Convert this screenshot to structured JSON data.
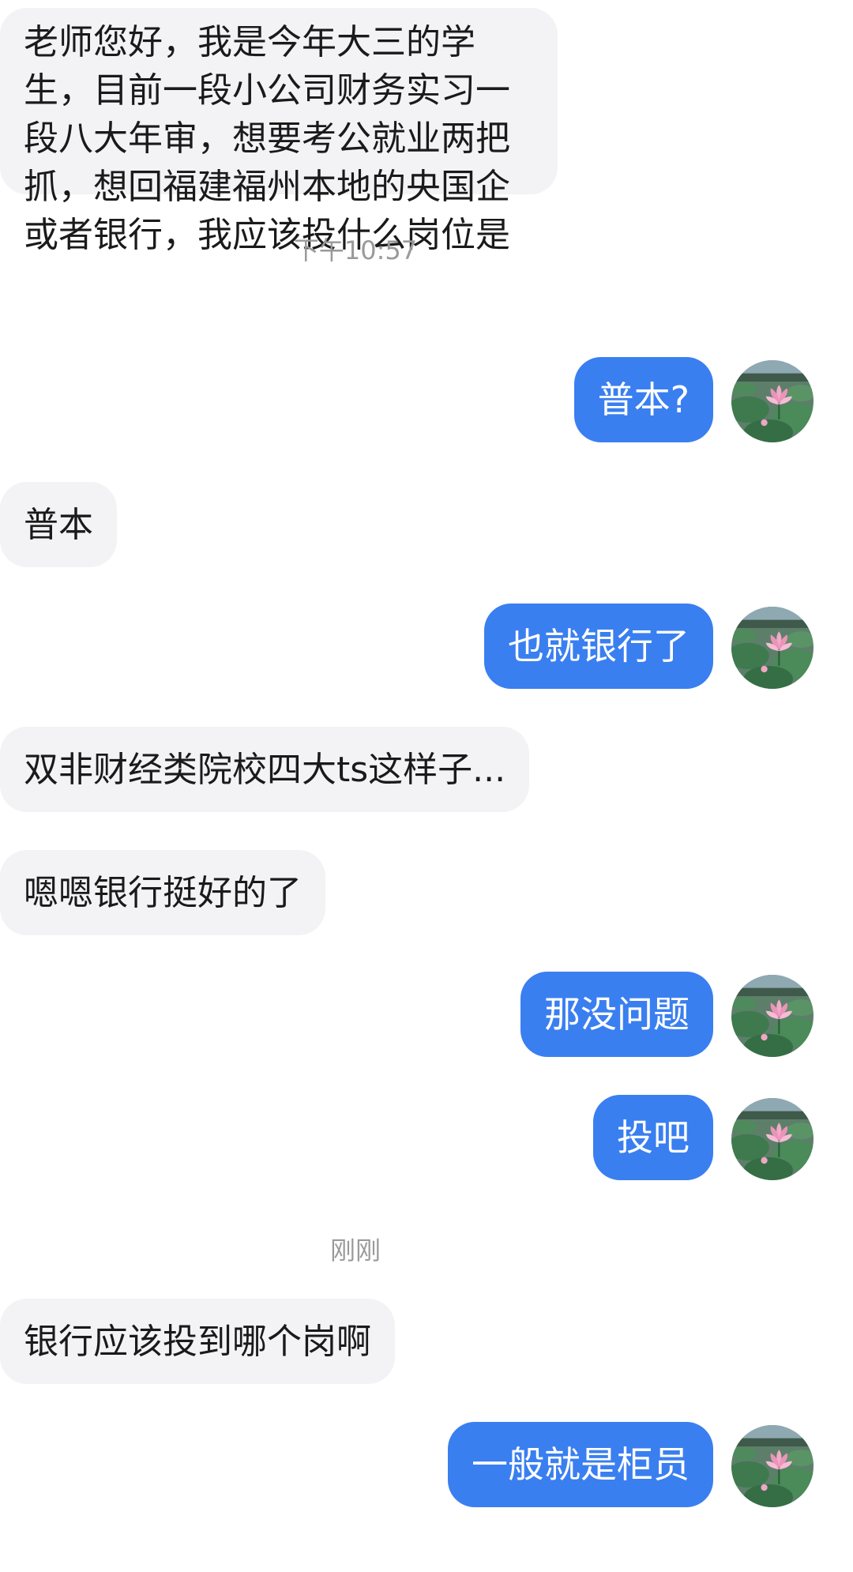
{
  "messages": [
    {
      "side": "in",
      "text": "老师您好，我是今年大三的学生，目前一段小公司财务实习一段八大年审，想要考公就业两把抓，想回福建福州本地的央国企或者银行，我应该投什么岗位是"
    },
    {
      "type": "timestamp",
      "text": "下午10:57"
    },
    {
      "side": "out",
      "text": "普本?"
    },
    {
      "side": "in",
      "text": "普本"
    },
    {
      "side": "out",
      "text": "也就银行了"
    },
    {
      "side": "in",
      "text": "双非财经类院校四大ts这样子..."
    },
    {
      "side": "in",
      "text": "嗯嗯银行挺好的了"
    },
    {
      "side": "out",
      "text": "那没问题"
    },
    {
      "side": "out",
      "text": "投吧"
    },
    {
      "type": "timestamp",
      "text": "刚刚"
    },
    {
      "side": "in",
      "text": "银行应该投到哪个岗啊"
    },
    {
      "side": "out",
      "text": "一般就是柜员"
    }
  ],
  "colors": {
    "outgoing_bubble": "#3a7ff0",
    "incoming_bubble": "#f3f3f5",
    "timestamp_text": "#9a9a9a"
  },
  "avatar": {
    "icon": "lotus-pond-avatar-icon"
  }
}
